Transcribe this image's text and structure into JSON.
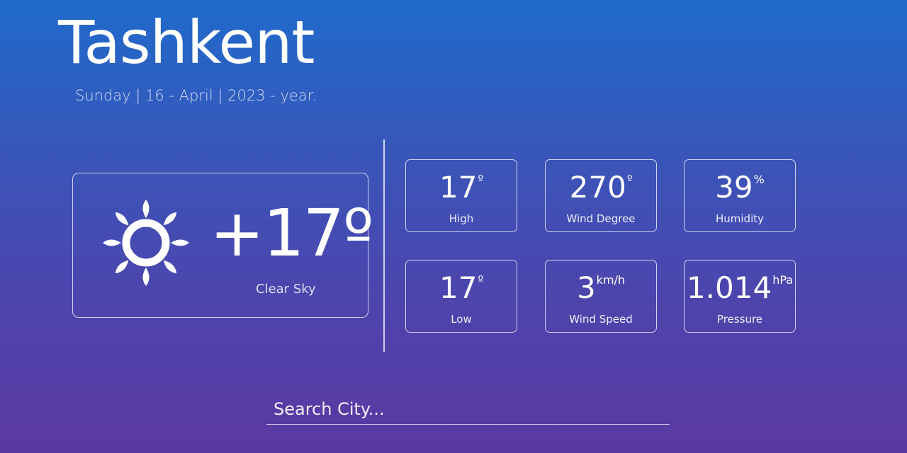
{
  "location": {
    "city": "Tashkent",
    "date": "Sunday | 16 - April | 2023 - year."
  },
  "current": {
    "temperature": "+17º",
    "condition": "Clear Sky",
    "icon": "sun-icon"
  },
  "stats": [
    {
      "value": "17",
      "unit": "º",
      "label": "High"
    },
    {
      "value": "270",
      "unit": "º",
      "label": "Wind Degree"
    },
    {
      "value": "39",
      "unit": "%",
      "label": "Humidity"
    },
    {
      "value": "17",
      "unit": "º",
      "label": "Low"
    },
    {
      "value": "3",
      "unit": "km/h",
      "label": "Wind Speed"
    },
    {
      "value": "1.014",
      "unit": "hPa",
      "label": "Pressure"
    }
  ],
  "search": {
    "placeholder": "Search City...",
    "value": ""
  },
  "colors": {
    "gradient_top": "#1f6bcc",
    "gradient_bottom": "#5c38a2",
    "text": "#ffffff"
  }
}
